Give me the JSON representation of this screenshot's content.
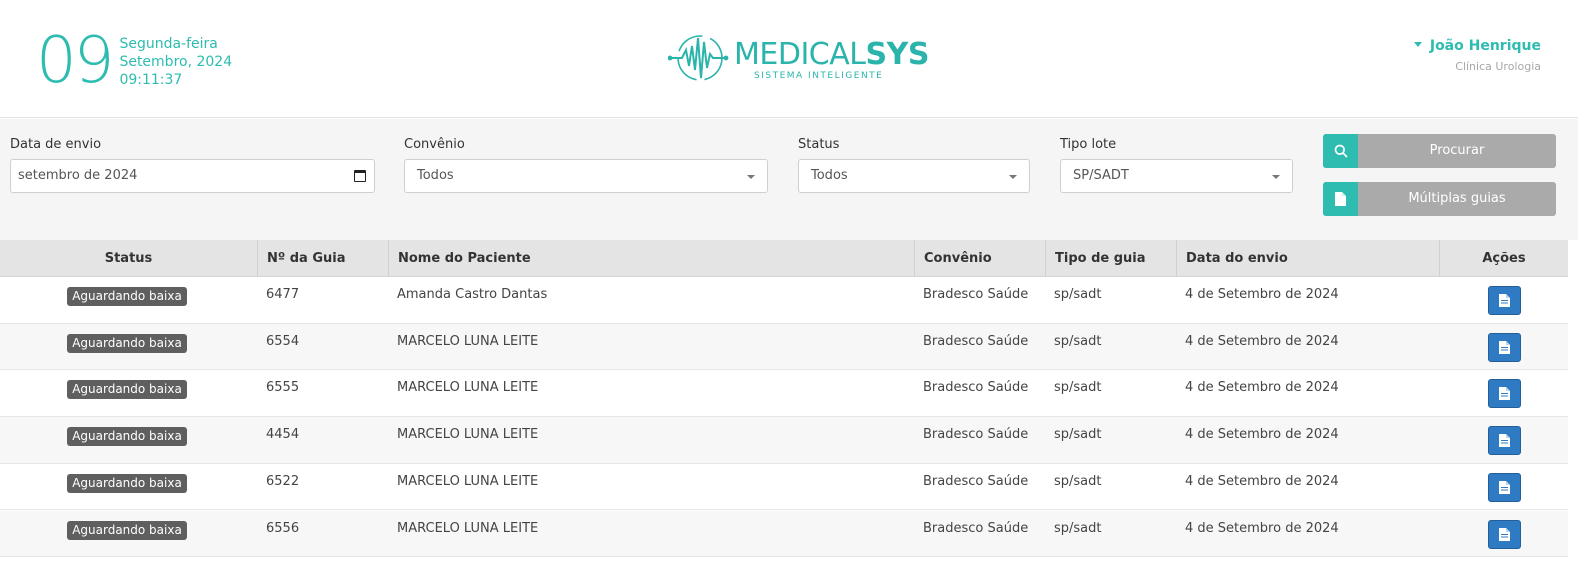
{
  "header": {
    "day": "09",
    "weekday": "Segunda-feira",
    "month_year": "Setembro, 2024",
    "time": "09:11:37",
    "logo_main": "MEDICAL",
    "logo_bold": "SYS",
    "logo_sub": "SISTEMA INTELIGENTE",
    "user_name": "João Henrique",
    "clinic": "Clínica Urologia",
    "accent_color": "#2ebcb0"
  },
  "filters": {
    "date": {
      "label": "Data de envio",
      "value": "setembro de 2024"
    },
    "convenio": {
      "label": "Convênio",
      "value": "Todos"
    },
    "status": {
      "label": "Status",
      "value": "Todos"
    },
    "tipo_lote": {
      "label": "Tipo lote",
      "value": "SP/SADT"
    },
    "search_button": {
      "label": "Procurar",
      "icon": "search-icon"
    },
    "multi_button": {
      "label": "Múltiplas guias",
      "icon": "document-icon"
    }
  },
  "table": {
    "columns": [
      "Status",
      "Nº da Guia",
      "Nome do Paciente",
      "Convênio",
      "Tipo de guia",
      "Data do envio",
      "Ações"
    ],
    "rows": [
      {
        "status": "Aguardando baixa",
        "guia": "6477",
        "paciente": "Amanda Castro Dantas",
        "convenio": "Bradesco Saúde",
        "tipo": "sp/sadt",
        "data": "4 de Setembro de 2024"
      },
      {
        "status": "Aguardando baixa",
        "guia": "6554",
        "paciente": "MARCELO LUNA LEITE",
        "convenio": "Bradesco Saúde",
        "tipo": "sp/sadt",
        "data": "4 de Setembro de 2024"
      },
      {
        "status": "Aguardando baixa",
        "guia": "6555",
        "paciente": "MARCELO LUNA LEITE",
        "convenio": "Bradesco Saúde",
        "tipo": "sp/sadt",
        "data": "4 de Setembro de 2024"
      },
      {
        "status": "Aguardando baixa",
        "guia": "4454",
        "paciente": "MARCELO LUNA LEITE",
        "convenio": "Bradesco Saúde",
        "tipo": "sp/sadt",
        "data": "4 de Setembro de 2024"
      },
      {
        "status": "Aguardando baixa",
        "guia": "6522",
        "paciente": "MARCELO LUNA LEITE",
        "convenio": "Bradesco Saúde",
        "tipo": "sp/sadt",
        "data": "4 de Setembro de 2024"
      },
      {
        "status": "Aguardando baixa",
        "guia": "6556",
        "paciente": "MARCELO LUNA LEITE",
        "convenio": "Bradesco Saúde",
        "tipo": "sp/sadt",
        "data": "4 de Setembro de 2024"
      }
    ]
  }
}
